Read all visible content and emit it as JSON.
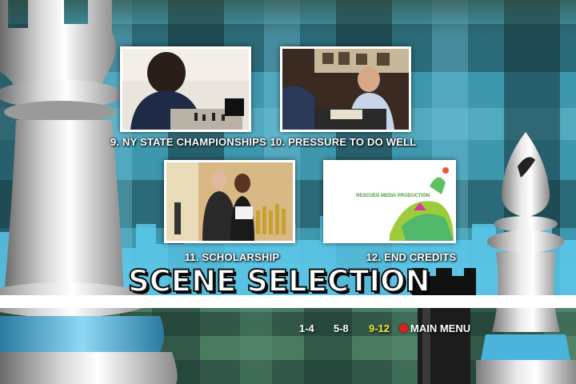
{
  "menu": {
    "title": "SCENE SELECTION",
    "scenes": [
      {
        "caption": "9. NY STATE CHAMPIONSHIPS"
      },
      {
        "caption": "10. PRESSURE TO DO WELL"
      },
      {
        "caption": "11. SCHOLARSHIP"
      },
      {
        "caption": "12. END CREDITS"
      }
    ],
    "end_credits_card": "RESCUED MEDIA PRODUCTION"
  },
  "nav": {
    "page_1": "1-4",
    "page_2": "5-8",
    "page_3": "9-12",
    "active_page": "9-12",
    "main_menu": "MAIN MENU"
  },
  "colors": {
    "active_nav": "#f2ee3a",
    "nav_text": "#ffffff",
    "main_menu_dot": "#e0201c",
    "background": "#3e98ad"
  }
}
